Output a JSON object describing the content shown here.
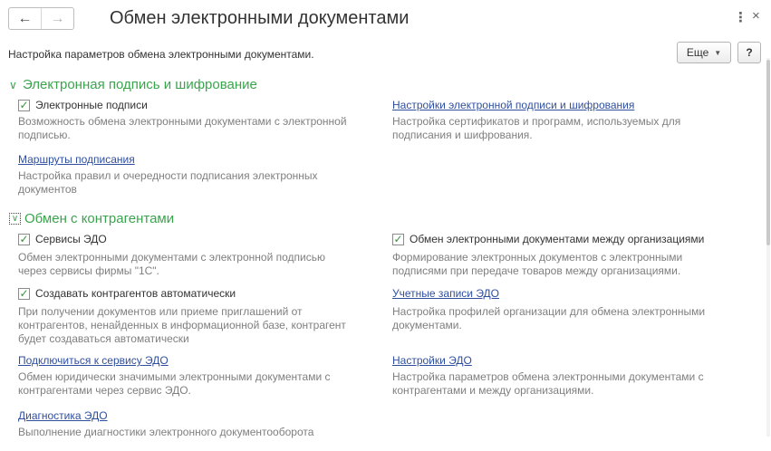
{
  "window": {
    "title": "Обмен электронными документами",
    "back_icon": "←",
    "forward_icon": "→",
    "more_icon": "⋮",
    "close_icon": "×"
  },
  "toolbar": {
    "subtitle": "Настройка параметров обмена электронными документами.",
    "more_label": "Еще",
    "help_label": "?"
  },
  "sections": {
    "signature": {
      "header": "Электронная подпись и шифрование",
      "e_signatures": {
        "label": "Электронные подписи",
        "checked": true,
        "desc": "Возможность обмена электронными документами с электронной\nподписью."
      },
      "signature_settings": {
        "label": "Настройки электронной подписи и шифрования",
        "desc": "Настройка сертификатов и программ, используемых для\nподписания и шифрования."
      },
      "signing_routes": {
        "label": "Маршруты подписания",
        "desc": "Настройка правил и очередности подписания электронных\nдокументов"
      }
    },
    "counterparties": {
      "header": "Обмен с контрагентами",
      "edo_services": {
        "label": "Сервисы ЭДО",
        "checked": true,
        "desc": "Обмен электронными документами с электронной подписью\nчерез сервисы фирмы \"1С\"."
      },
      "between_orgs": {
        "label": "Обмен электронными документами между организациями",
        "checked": true,
        "desc": "Формирование электронных документов с электронными\nподписями при передаче товаров между организациями."
      },
      "auto_create": {
        "label": "Создавать контрагентов автоматически",
        "checked": true,
        "desc": "При получении документов или приеме приглашений от\nконтрагентов, ненайденных в информационной базе, контрагент\nбудет создаваться автоматически"
      },
      "edo_accounts": {
        "label": "Учетные записи ЭДО",
        "desc": "Настройка профилей организации для обмена электронными\nдокументами."
      },
      "connect_service": {
        "label": "Подключиться к сервису ЭДО",
        "desc": "Обмен юридически значимыми электронными документами с\nконтрагентами через сервис ЭДО."
      },
      "edo_settings": {
        "label": "Настройки ЭДО",
        "desc": "Настройка параметров обмена электронными документами с\nконтрагентами и между организациями."
      },
      "diagnostics": {
        "label": "Диагностика ЭДО",
        "desc": "Выполнение диагностики электронного документооборота"
      }
    }
  }
}
